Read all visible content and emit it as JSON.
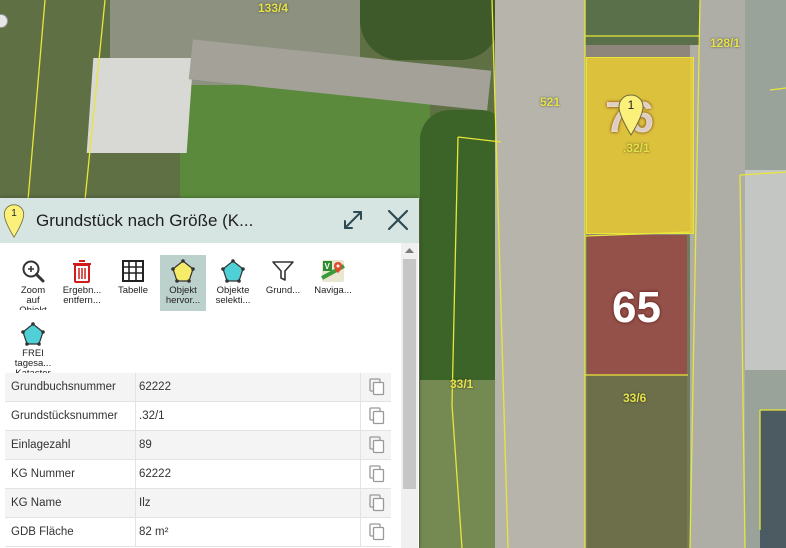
{
  "map": {
    "parcel_labels": [
      "133/4",
      "128/1",
      "521",
      ".32/1",
      "33/1",
      "33/6"
    ],
    "house_numbers": [
      "76",
      "65"
    ],
    "marker_number": "1",
    "colors": {
      "parcel_line": "#e8e63a",
      "selection_fill": "#f2d22c",
      "road": "#b7b5ab"
    }
  },
  "panel": {
    "marker_number": "1",
    "title": "Grundstück nach Größe (K...",
    "expand_icon": "expand-arrows-icon",
    "close_icon": "close-icon",
    "colors": {
      "header_bg": "#d7e5e2",
      "active_tool_bg": "#bcd0cc"
    }
  },
  "toolbar": {
    "tools": [
      {
        "label": "Zoom\nauf\nObjekt",
        "icon": "zoom-icon"
      },
      {
        "label": "Ergebn...\nentfern...",
        "icon": "trash-icon"
      },
      {
        "label": "Tabelle",
        "icon": "table-icon"
      },
      {
        "label": "Objekt\nhervor...",
        "icon": "highlight-polygon-icon"
      },
      {
        "label": "Objekte\nselekti...",
        "icon": "select-polygon-icon"
      },
      {
        "label": "Grund...",
        "icon": "filter-icon"
      },
      {
        "label": "Naviga...",
        "icon": "navigation-icon"
      },
      {
        "label": "FREI\ntagesa...\nKataster",
        "icon": "cadastre-polygon-icon"
      }
    ]
  },
  "attributes": {
    "rows": [
      {
        "key": "Grundbuchsnummer",
        "value": "62222"
      },
      {
        "key": "Grundstücksnummer",
        "value": ".32/1"
      },
      {
        "key": "Einlagezahl",
        "value": "89"
      },
      {
        "key": "KG Nummer",
        "value": "62222"
      },
      {
        "key": "KG Name",
        "value": "Ilz"
      },
      {
        "key": "GDB Fläche",
        "value": "82 m²"
      }
    ],
    "copy_icon": "copy-icon"
  }
}
